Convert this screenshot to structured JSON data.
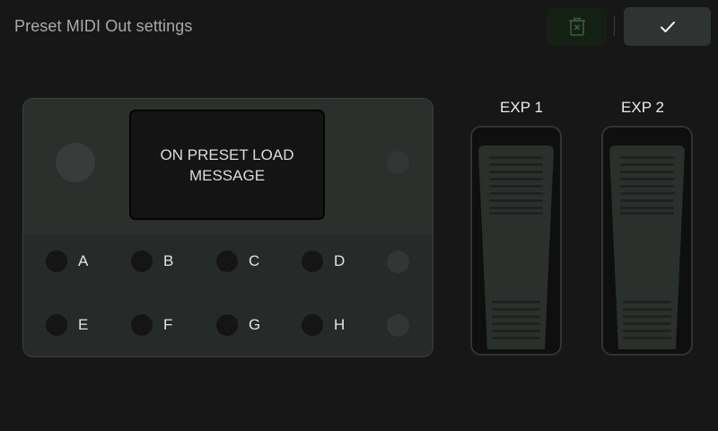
{
  "header": {
    "title": "Preset MIDI Out settings",
    "delete_icon": "trash-x-icon",
    "confirm_icon": "checkmark-icon"
  },
  "device": {
    "screen_message": "ON PRESET LOAD MESSAGE",
    "footswitches_row1": [
      "A",
      "B",
      "C",
      "D"
    ],
    "footswitches_row2": [
      "E",
      "F",
      "G",
      "H"
    ]
  },
  "expression": {
    "exp1_label": "EXP 1",
    "exp2_label": "EXP 2"
  },
  "colors": {
    "background": "#171717",
    "delete_button": "#152015",
    "confirm_button": "#2f3331"
  }
}
